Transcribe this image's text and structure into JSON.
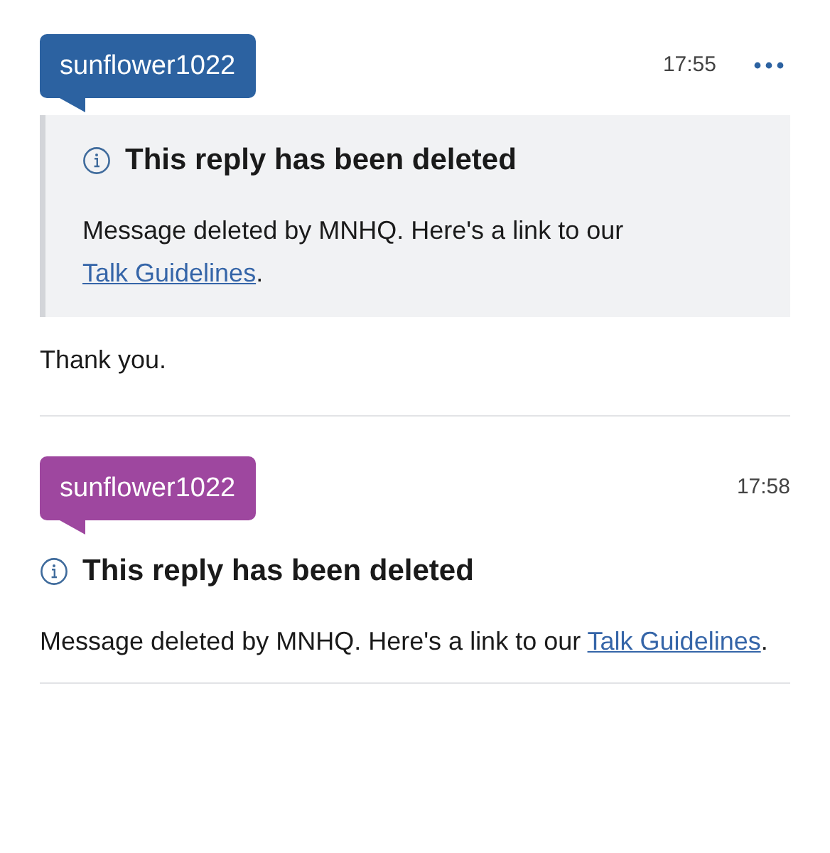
{
  "posts": [
    {
      "username": "sunflower1022",
      "color": "#2c62a1",
      "time": "17:55",
      "menu": true,
      "quoted": true,
      "notice": {
        "title": "This reply has been deleted",
        "text": "Message deleted by MNHQ. Here's a link to our",
        "link": "Talk Guidelines",
        "after": "."
      },
      "reply": "Thank you."
    },
    {
      "username": "sunflower1022",
      "color": "#9e479f",
      "time": "17:58",
      "menu": false,
      "quoted": false,
      "notice": {
        "title": "This reply has been deleted",
        "text": "Message deleted by MNHQ. Here's a link to our",
        "link": "Talk Guidelines",
        "after": "."
      }
    }
  ]
}
